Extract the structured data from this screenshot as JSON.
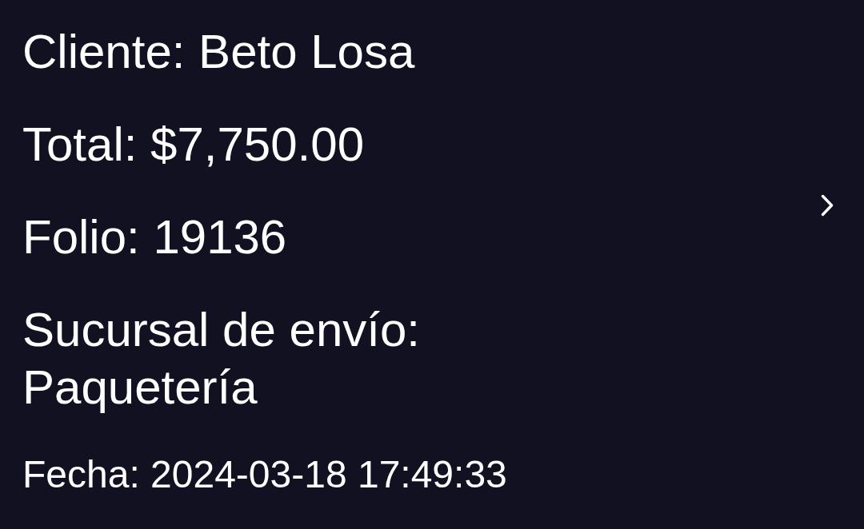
{
  "order": {
    "client": "Cliente: Beto Losa",
    "total": "Total: $7,750.00",
    "folio": "Folio: 19136",
    "shipping_branch": "Sucursal de envío:\nPaquetería",
    "date": "Fecha: 2024-03-18 17:49:33"
  }
}
